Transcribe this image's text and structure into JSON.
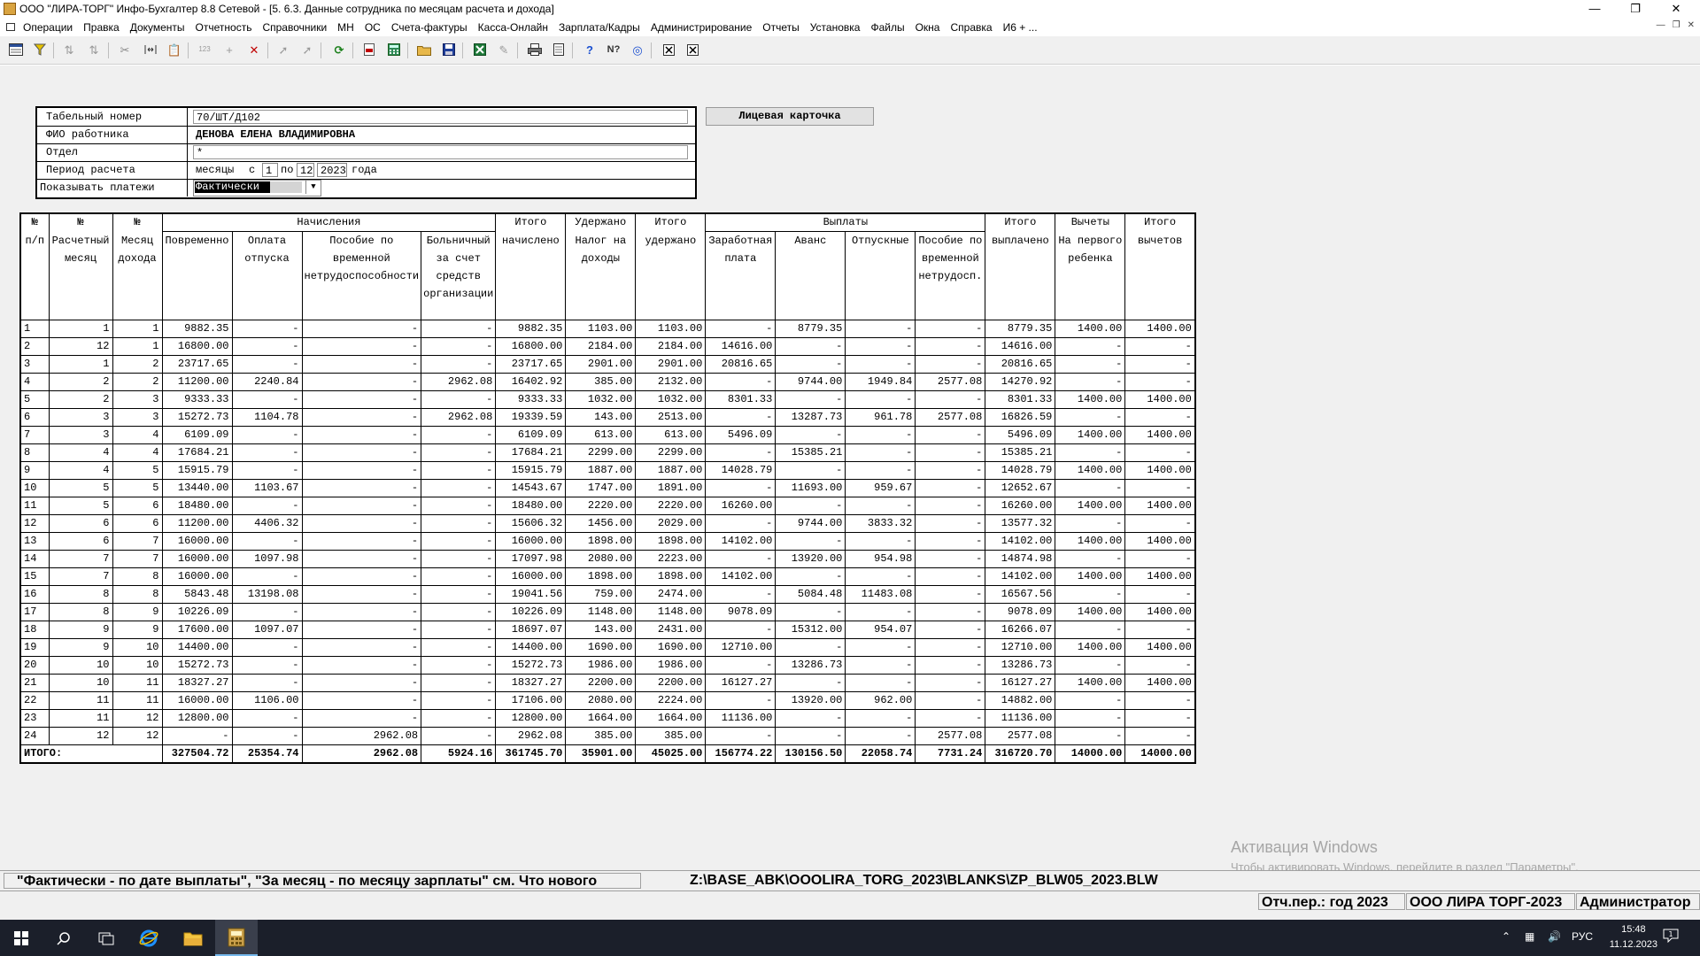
{
  "window": {
    "title": "ООО \"ЛИРА-ТОРГ\" Инфо-Бухгалтер 8.8 Сетевой - [5. 6.3. Данные сотрудника по месяцам расчета и дохода]",
    "min_icon": "minimize-icon",
    "max_icon": "restore-icon",
    "close_icon": "close-icon"
  },
  "menu": {
    "items": [
      "Операции",
      "Правка",
      "Документы",
      "Отчетность",
      "Справочники",
      "МН",
      "ОС",
      "Счета-фактуры",
      "Касса-Онлайн",
      "Зарплата/Кадры",
      "Администрирование",
      "Отчеты",
      "Установка",
      "Файлы",
      "Окна",
      "Справка",
      "И6 + ..."
    ]
  },
  "toolbar": {
    "icons": [
      "window-icon",
      "filter-icon",
      "sort-asc-icon",
      "sort-desc-icon",
      "cut-icon",
      "columns-icon",
      "paste-icon",
      "number-icon",
      "add-icon",
      "delete-icon",
      "pointer-icon",
      "pointer2-icon",
      "refresh-icon",
      "pdf-icon",
      "calculator-icon",
      "open-folder-icon",
      "save-icon",
      "excel-icon",
      "tools-icon",
      "print-icon",
      "preview-icon",
      "help-icon",
      "context-help-icon",
      "web-icon",
      "close-window-icon",
      "close-all-icon"
    ]
  },
  "form": {
    "tab_label": "Табельный номер",
    "tab_value": "70/ШТ/Д102",
    "fio_label": "ФИО работника",
    "fio_value": "ДЕНОВА ЕЛЕНА ВЛАДИМИРОВНА",
    "dept_label": "Отдел",
    "dept_value": "*",
    "period_label": "Период расчета",
    "period_months": "месяцы",
    "period_from": "с",
    "period_from_value": "1",
    "period_to": "по",
    "period_to_value": "12",
    "period_year_value": "2023",
    "period_year": "года",
    "show_label": "Показывать платежи",
    "show_value": "Фактически"
  },
  "card_button": "Лицевая карточка",
  "table": {
    "group": {
      "accruals": "Начисления",
      "payments": "Выплаты",
      "deductions": "Вычеты"
    },
    "columns": [
      {
        "top": "№",
        "text": "п/п"
      },
      {
        "top": "№",
        "text": "Расчетный месяц"
      },
      {
        "top": "№",
        "text": "Месяц дохода"
      },
      {
        "top": "",
        "text": "Повременно"
      },
      {
        "top": "",
        "text": "Оплата отпуска"
      },
      {
        "top": "",
        "text": "Пособие по временной нетрудоспособности"
      },
      {
        "top": "",
        "text": "Больничный за счет средств организации"
      },
      {
        "top": "Итого",
        "text": "начислено"
      },
      {
        "top": "Удержано",
        "text": "Налог на доходы"
      },
      {
        "top": "Итого",
        "text": "удержано"
      },
      {
        "top": "",
        "text": "Заработная плата"
      },
      {
        "top": "",
        "text": "Аванс"
      },
      {
        "top": "",
        "text": "Отпускные"
      },
      {
        "top": "",
        "text": "Пособие по временной нетрудосп."
      },
      {
        "top": "Итого",
        "text": "выплачено"
      },
      {
        "top": "",
        "text": "На первого ребенка"
      },
      {
        "top": "Итого",
        "text": "вычетов"
      }
    ],
    "rows": [
      [
        "1",
        "1",
        "1",
        "9882.35",
        "-",
        "-",
        "-",
        "9882.35",
        "1103.00",
        "1103.00",
        "-",
        "8779.35",
        "-",
        "-",
        "8779.35",
        "1400.00",
        "1400.00"
      ],
      [
        "2",
        "12",
        "1",
        "16800.00",
        "-",
        "-",
        "-",
        "16800.00",
        "2184.00",
        "2184.00",
        "14616.00",
        "-",
        "-",
        "-",
        "14616.00",
        "-",
        "-"
      ],
      [
        "3",
        "1",
        "2",
        "23717.65",
        "-",
        "-",
        "-",
        "23717.65",
        "2901.00",
        "2901.00",
        "20816.65",
        "-",
        "-",
        "-",
        "20816.65",
        "-",
        "-"
      ],
      [
        "4",
        "2",
        "2",
        "11200.00",
        "2240.84",
        "-",
        "2962.08",
        "16402.92",
        "385.00",
        "2132.00",
        "-",
        "9744.00",
        "1949.84",
        "2577.08",
        "14270.92",
        "-",
        "-"
      ],
      [
        "5",
        "2",
        "3",
        "9333.33",
        "-",
        "-",
        "-",
        "9333.33",
        "1032.00",
        "1032.00",
        "8301.33",
        "-",
        "-",
        "-",
        "8301.33",
        "1400.00",
        "1400.00"
      ],
      [
        "6",
        "3",
        "3",
        "15272.73",
        "1104.78",
        "-",
        "2962.08",
        "19339.59",
        "143.00",
        "2513.00",
        "-",
        "13287.73",
        "961.78",
        "2577.08",
        "16826.59",
        "-",
        "-"
      ],
      [
        "7",
        "3",
        "4",
        "6109.09",
        "-",
        "-",
        "-",
        "6109.09",
        "613.00",
        "613.00",
        "5496.09",
        "-",
        "-",
        "-",
        "5496.09",
        "1400.00",
        "1400.00"
      ],
      [
        "8",
        "4",
        "4",
        "17684.21",
        "-",
        "-",
        "-",
        "17684.21",
        "2299.00",
        "2299.00",
        "-",
        "15385.21",
        "-",
        "-",
        "15385.21",
        "-",
        "-"
      ],
      [
        "9",
        "4",
        "5",
        "15915.79",
        "-",
        "-",
        "-",
        "15915.79",
        "1887.00",
        "1887.00",
        "14028.79",
        "-",
        "-",
        "-",
        "14028.79",
        "1400.00",
        "1400.00"
      ],
      [
        "10",
        "5",
        "5",
        "13440.00",
        "1103.67",
        "-",
        "-",
        "14543.67",
        "1747.00",
        "1891.00",
        "-",
        "11693.00",
        "959.67",
        "-",
        "12652.67",
        "-",
        "-"
      ],
      [
        "11",
        "5",
        "6",
        "18480.00",
        "-",
        "-",
        "-",
        "18480.00",
        "2220.00",
        "2220.00",
        "16260.00",
        "-",
        "-",
        "-",
        "16260.00",
        "1400.00",
        "1400.00"
      ],
      [
        "12",
        "6",
        "6",
        "11200.00",
        "4406.32",
        "-",
        "-",
        "15606.32",
        "1456.00",
        "2029.00",
        "-",
        "9744.00",
        "3833.32",
        "-",
        "13577.32",
        "-",
        "-"
      ],
      [
        "13",
        "6",
        "7",
        "16000.00",
        "-",
        "-",
        "-",
        "16000.00",
        "1898.00",
        "1898.00",
        "14102.00",
        "-",
        "-",
        "-",
        "14102.00",
        "1400.00",
        "1400.00"
      ],
      [
        "14",
        "7",
        "7",
        "16000.00",
        "1097.98",
        "-",
        "-",
        "17097.98",
        "2080.00",
        "2223.00",
        "-",
        "13920.00",
        "954.98",
        "-",
        "14874.98",
        "-",
        "-"
      ],
      [
        "15",
        "7",
        "8",
        "16000.00",
        "-",
        "-",
        "-",
        "16000.00",
        "1898.00",
        "1898.00",
        "14102.00",
        "-",
        "-",
        "-",
        "14102.00",
        "1400.00",
        "1400.00"
      ],
      [
        "16",
        "8",
        "8",
        "5843.48",
        "13198.08",
        "-",
        "-",
        "19041.56",
        "759.00",
        "2474.00",
        "-",
        "5084.48",
        "11483.08",
        "-",
        "16567.56",
        "-",
        "-"
      ],
      [
        "17",
        "8",
        "9",
        "10226.09",
        "-",
        "-",
        "-",
        "10226.09",
        "1148.00",
        "1148.00",
        "9078.09",
        "-",
        "-",
        "-",
        "9078.09",
        "1400.00",
        "1400.00"
      ],
      [
        "18",
        "9",
        "9",
        "17600.00",
        "1097.07",
        "-",
        "-",
        "18697.07",
        "143.00",
        "2431.00",
        "-",
        "15312.00",
        "954.07",
        "-",
        "16266.07",
        "-",
        "-"
      ],
      [
        "19",
        "9",
        "10",
        "14400.00",
        "-",
        "-",
        "-",
        "14400.00",
        "1690.00",
        "1690.00",
        "12710.00",
        "-",
        "-",
        "-",
        "12710.00",
        "1400.00",
        "1400.00"
      ],
      [
        "20",
        "10",
        "10",
        "15272.73",
        "-",
        "-",
        "-",
        "15272.73",
        "1986.00",
        "1986.00",
        "-",
        "13286.73",
        "-",
        "-",
        "13286.73",
        "-",
        "-"
      ],
      [
        "21",
        "10",
        "11",
        "18327.27",
        "-",
        "-",
        "-",
        "18327.27",
        "2200.00",
        "2200.00",
        "16127.27",
        "-",
        "-",
        "-",
        "16127.27",
        "1400.00",
        "1400.00"
      ],
      [
        "22",
        "11",
        "11",
        "16000.00",
        "1106.00",
        "-",
        "-",
        "17106.00",
        "2080.00",
        "2224.00",
        "-",
        "13920.00",
        "962.00",
        "-",
        "14882.00",
        "-",
        "-"
      ],
      [
        "23",
        "11",
        "12",
        "12800.00",
        "-",
        "-",
        "-",
        "12800.00",
        "1664.00",
        "1664.00",
        "11136.00",
        "-",
        "-",
        "-",
        "11136.00",
        "-",
        "-"
      ],
      [
        "24",
        "12",
        "12",
        "-",
        "-",
        "2962.08",
        "-",
        "2962.08",
        "385.00",
        "385.00",
        "-",
        "-",
        "-",
        "2577.08",
        "2577.08",
        "-",
        "-"
      ]
    ],
    "total_label": "ИТОГО:",
    "totals": [
      "327504.72",
      "25354.74",
      "2962.08",
      "5924.16",
      "361745.70",
      "35901.00",
      "45025.00",
      "156774.22",
      "130156.50",
      "22058.74",
      "7731.24",
      "316720.70",
      "14000.00",
      "14000.00"
    ]
  },
  "activation": {
    "title": "Активация Windows",
    "text": "Чтобы активировать Windows, перейдите в раздел \"Параметры\"."
  },
  "status": {
    "hint": "\"Фактически - по дате выплаты\", \"За месяц - по месяцу зарплаты\" см. Что нового",
    "path": "Z:\\BASE_ABK\\OOOLIRA_TORG_2023\\BLANKS\\ZP_BLW05_2023.BLW",
    "period": "Отч.пер.: год 2023",
    "org": "ООО ЛИРА ТОРГ-2023",
    "user": "Администратор"
  },
  "taskbar": {
    "lang": "РУС",
    "time": "15:48",
    "date": "11.12.2023",
    "notify_count": "1"
  },
  "colors": {
    "taskbar": "#1b1f2a",
    "window_bg": "#f0f0f0",
    "grid_bg": "#ffffff"
  }
}
